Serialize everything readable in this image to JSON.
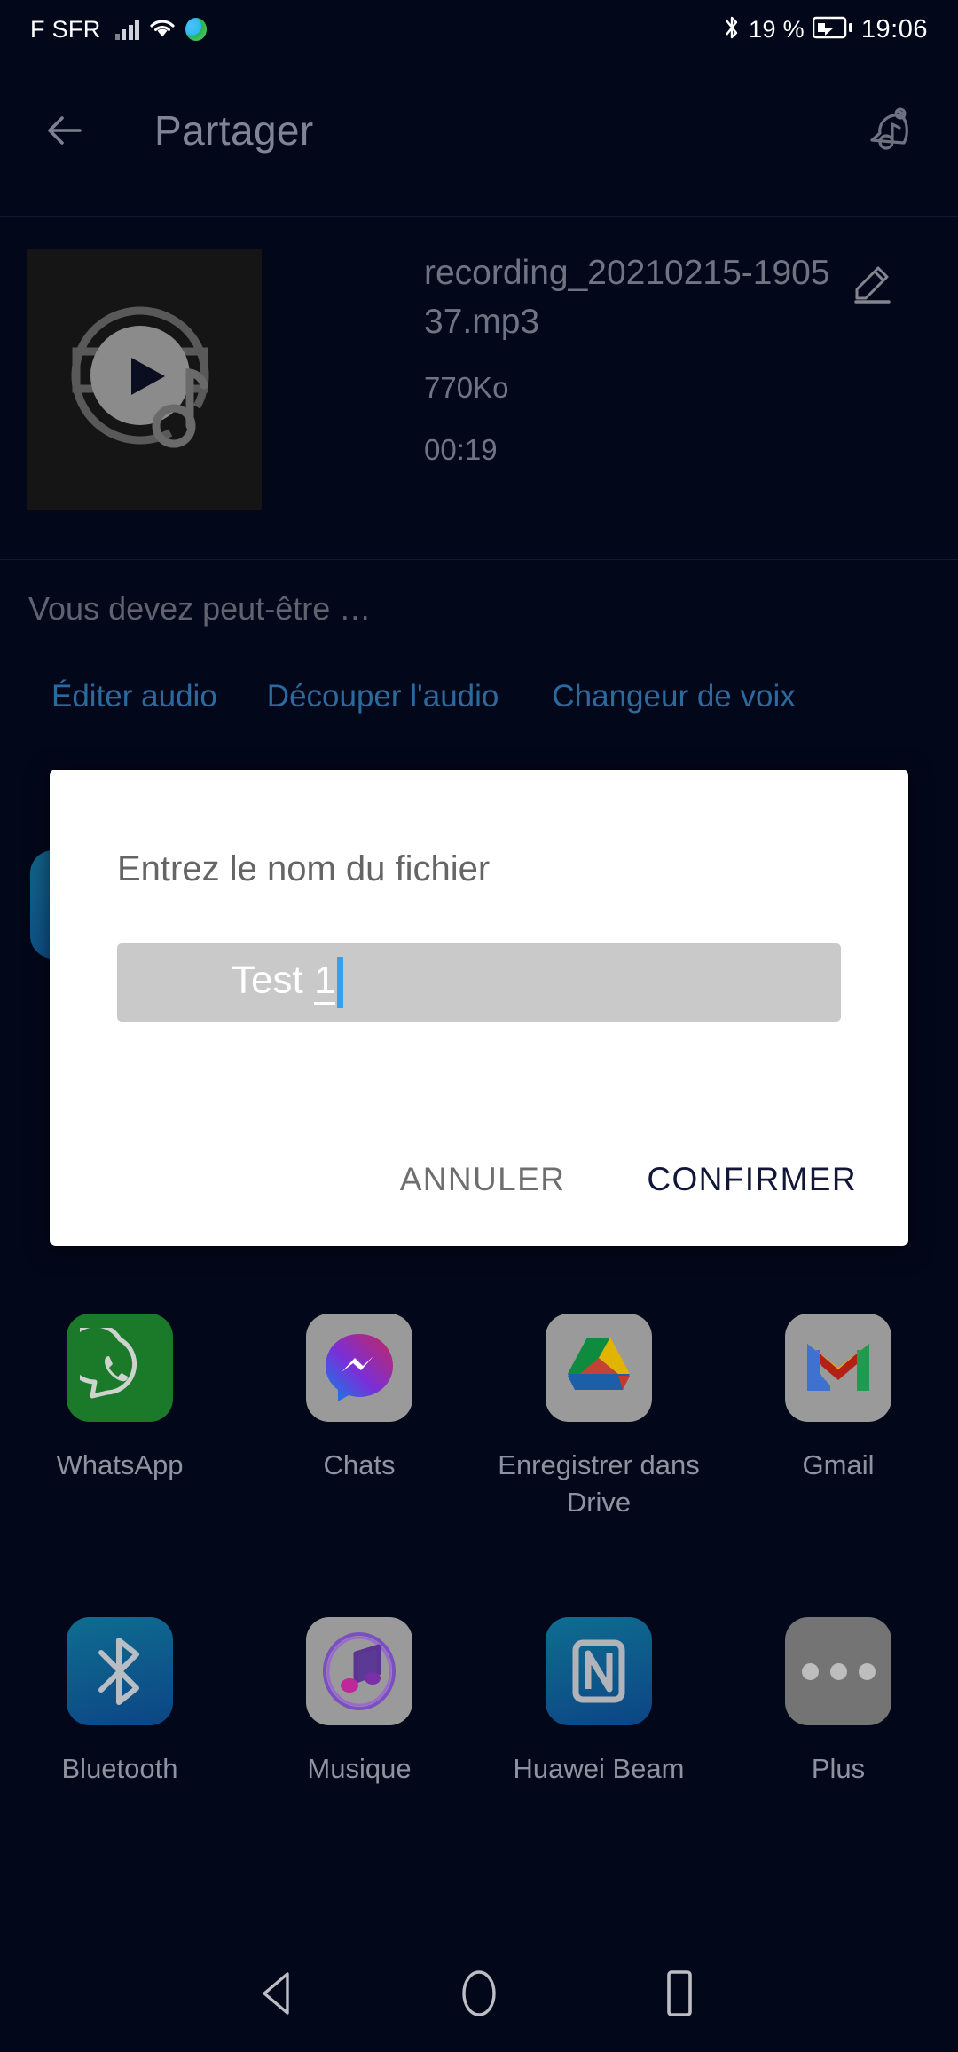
{
  "status_bar": {
    "carrier": "F SFR",
    "battery_percent": "19 %",
    "time": "19:06",
    "icons": [
      "signal-bars-icon",
      "wifi-icon",
      "globe-icon",
      "bluetooth-icon",
      "battery-charging-icon"
    ]
  },
  "app_bar": {
    "title": "Partager",
    "back_icon": "back-arrow-icon",
    "ringtone_icon": "bell-music-icon"
  },
  "file": {
    "name": "recording_20210215-190537.mp3",
    "size": "770Ko",
    "duration": "00:19",
    "thumbnail_icon": "audio-disc-play-icon",
    "edit_icon": "pencil-icon"
  },
  "suggestion": {
    "label": "Vous devez peut-être …",
    "links": [
      {
        "label": "Éditer audio"
      },
      {
        "label": "Découper l'audio"
      },
      {
        "label": "Changeur de voix"
      }
    ]
  },
  "dialog": {
    "title": "Entrez le nom du fichier",
    "input_value": "Test ",
    "input_composing": "1",
    "cancel_label": "ANNULER",
    "confirm_label": "CONFIRMER",
    "caret_color": "#34a0ef",
    "confirm_color": "#121739"
  },
  "share_targets": {
    "row1": [
      {
        "label": "WhatsApp",
        "icon": "whatsapp-icon"
      },
      {
        "label": "Chats",
        "icon": "messenger-icon"
      },
      {
        "label": "Enregistrer dans Drive",
        "icon": "google-drive-icon"
      },
      {
        "label": "Gmail",
        "icon": "gmail-icon"
      }
    ],
    "row2": [
      {
        "label": "Bluetooth",
        "icon": "bluetooth-icon"
      },
      {
        "label": "Musique",
        "icon": "music-note-icon"
      },
      {
        "label": "Huawei Beam",
        "icon": "nfc-icon"
      },
      {
        "label": "Plus",
        "icon": "more-dots-icon"
      }
    ]
  },
  "nav_bar": {
    "back": "nav-back-icon",
    "home": "nav-home-icon",
    "recents": "nav-recents-icon"
  },
  "colors": {
    "background": "#03071a",
    "link": "#2b6a9e",
    "dialog_bg": "#ffffff",
    "input_bg": "#c9c9c9"
  }
}
